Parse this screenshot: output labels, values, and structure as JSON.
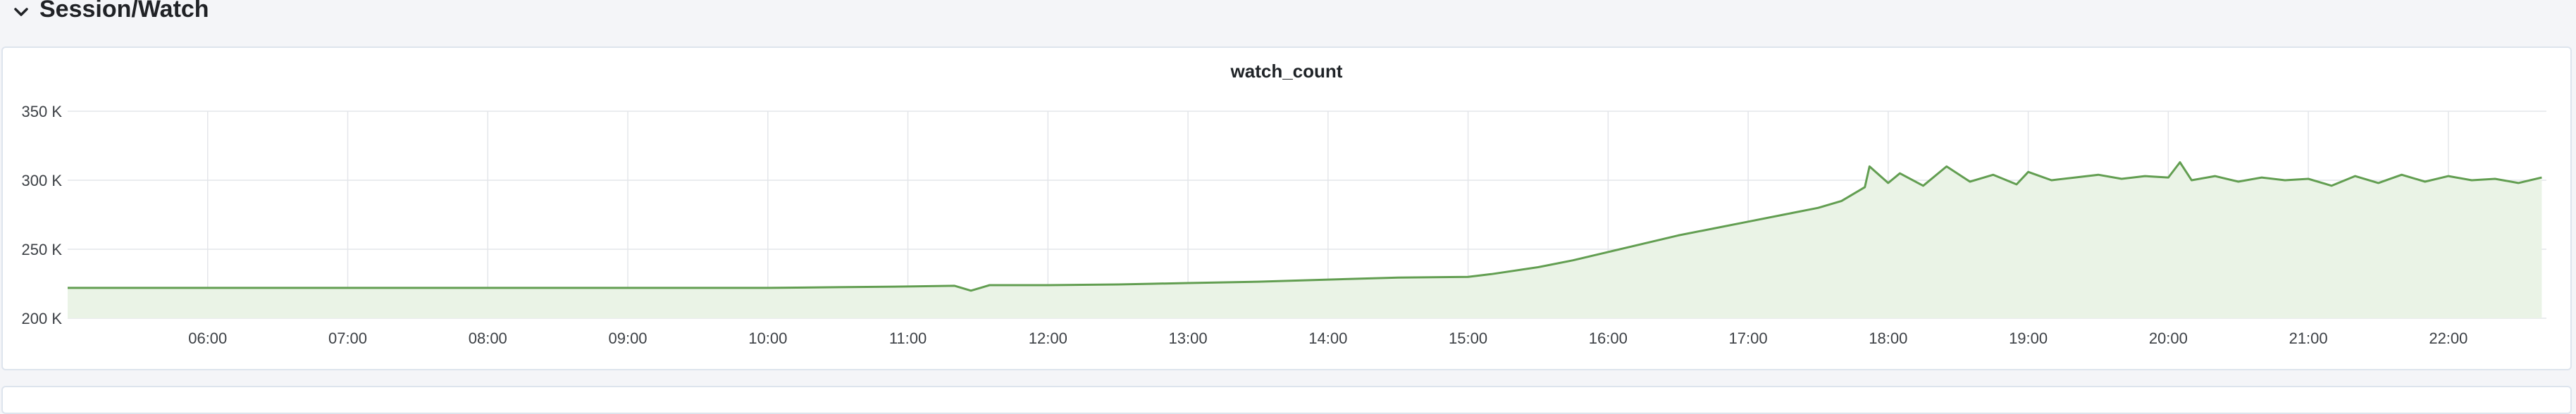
{
  "row": {
    "title": "Session/Watch"
  },
  "chart_data": {
    "type": "area",
    "title": "watch_count",
    "xlabel": "",
    "ylabel": "",
    "grid": true,
    "x_ticks": [
      "06:00",
      "07:00",
      "08:00",
      "09:00",
      "10:00",
      "11:00",
      "12:00",
      "13:00",
      "14:00",
      "15:00",
      "16:00",
      "17:00",
      "18:00",
      "19:00",
      "20:00",
      "21:00",
      "22:00"
    ],
    "y_ticks": [
      {
        "value": 200000,
        "label": "200 K"
      },
      {
        "value": 250000,
        "label": "250 K"
      },
      {
        "value": 300000,
        "label": "300 K"
      },
      {
        "value": 350000,
        "label": "350 K"
      }
    ],
    "ylim": [
      200000,
      350000
    ],
    "xlim_hours": [
      5.0,
      22.7
    ],
    "colors": {
      "line": "#629e51",
      "fill": "#eaf3e6"
    },
    "series": [
      {
        "x": [
          "05:00",
          "06:00",
          "07:00",
          "08:00",
          "09:00",
          "10:00",
          "10:30",
          "11:00",
          "11:20",
          "11:27",
          "11:35",
          "12:00",
          "12:30",
          "12:45",
          "13:00",
          "13:30",
          "14:00",
          "14:30",
          "15:00",
          "15:10",
          "15:30",
          "15:45",
          "16:00",
          "16:15",
          "16:30",
          "16:45",
          "17:00",
          "17:15",
          "17:30",
          "17:40",
          "17:50",
          "17:52",
          "18:00",
          "18:05",
          "18:15",
          "18:25",
          "18:35",
          "18:45",
          "18:55",
          "19:00",
          "19:10",
          "19:20",
          "19:30",
          "19:40",
          "19:50",
          "20:00",
          "20:05",
          "20:10",
          "20:20",
          "20:30",
          "20:40",
          "20:50",
          "21:00",
          "21:10",
          "21:20",
          "21:30",
          "21:40",
          "21:50",
          "22:00",
          "22:10",
          "22:20",
          "22:30",
          "22:40"
        ],
        "values": [
          222000,
          222000,
          222000,
          222000,
          222000,
          222000,
          222500,
          223000,
          223500,
          220000,
          224000,
          224000,
          224500,
          225000,
          225500,
          226500,
          228000,
          229500,
          230000,
          232000,
          237000,
          242000,
          248000,
          254000,
          260000,
          265000,
          270000,
          275000,
          280000,
          285000,
          295000,
          310000,
          298000,
          305000,
          296000,
          310000,
          299000,
          304000,
          297000,
          306000,
          300000,
          302000,
          304000,
          301000,
          303000,
          302000,
          313000,
          300000,
          303000,
          299000,
          302000,
          300000,
          301000,
          296000,
          303000,
          298000,
          304000,
          299000,
          303000,
          300000,
          301000,
          298000,
          302000
        ]
      }
    ]
  }
}
